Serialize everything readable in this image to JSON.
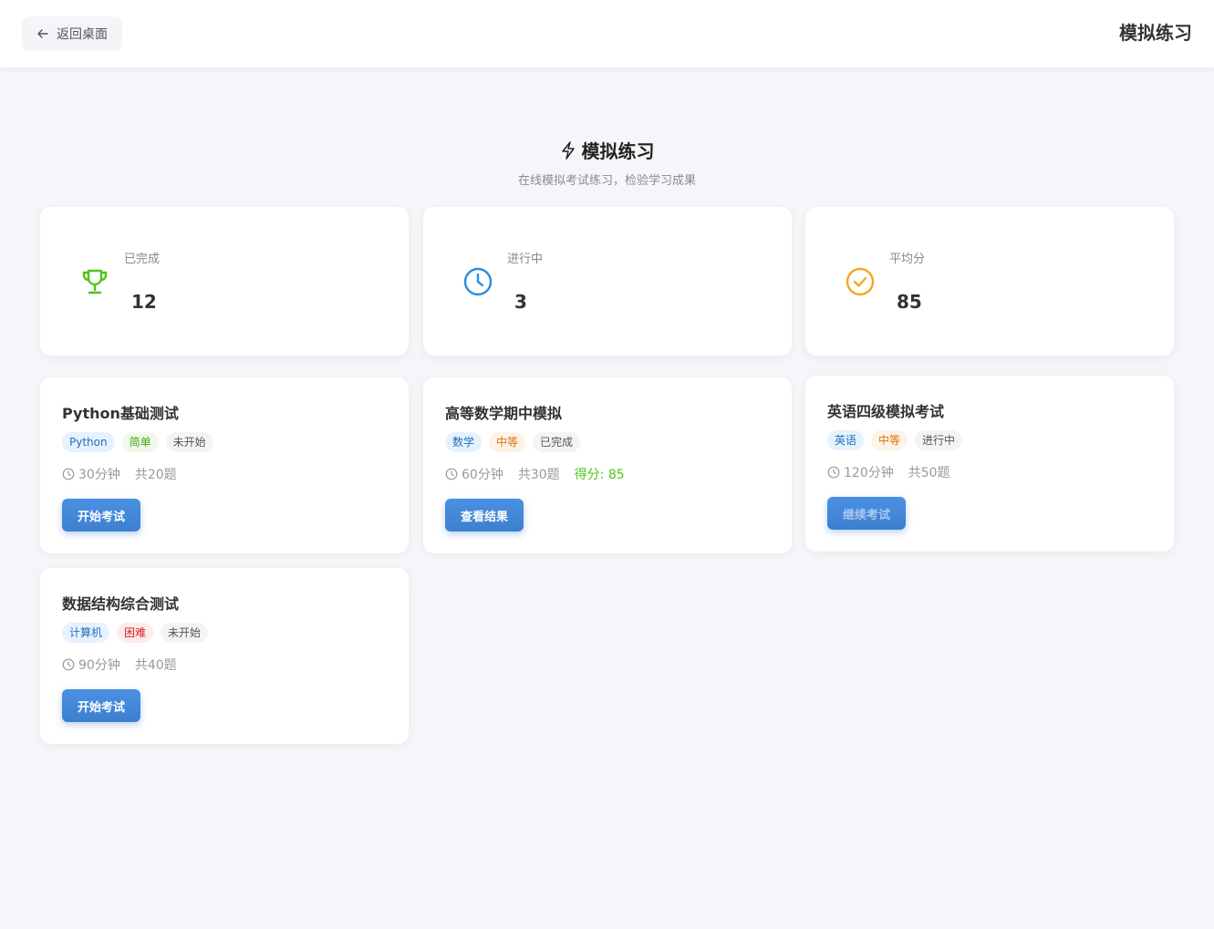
{
  "header": {
    "back_label": "返回桌面",
    "title": "模拟练习"
  },
  "page": {
    "title": "模拟练习",
    "subtitle": "在线模拟考试练习，检验学习成果"
  },
  "colors": {
    "primary": "#3d7fcf",
    "success": "#52c41a",
    "clock": "#2b8de0",
    "check": "#f5a623"
  },
  "stats": [
    {
      "label": "已完成",
      "value": "12",
      "icon": "trophy-icon"
    },
    {
      "label": "进行中",
      "value": "3",
      "icon": "clock-icon"
    },
    {
      "label": "平均分",
      "value": "85",
      "icon": "check-circle-icon"
    }
  ],
  "exams": [
    {
      "title": "Python基础测试",
      "tags": [
        "Python",
        "简单",
        "未开始"
      ],
      "duration": "30分钟",
      "count": "共20题",
      "score": "",
      "action": "开始考试"
    },
    {
      "title": "高等数学期中模拟",
      "tags": [
        "数学",
        "中等",
        "已完成"
      ],
      "duration": "60分钟",
      "count": "共30题",
      "score": "得分: 85",
      "action": "查看结果"
    },
    {
      "title": "英语四级模拟考试",
      "tags": [
        "英语",
        "中等",
        "进行中"
      ],
      "duration": "120分钟",
      "count": "共50题",
      "score": "",
      "action": "继续考试"
    },
    {
      "title": "数据结构综合测试",
      "tags": [
        "计算机",
        "困难",
        "未开始"
      ],
      "duration": "90分钟",
      "count": "共40题",
      "score": "",
      "action": "开始考试"
    }
  ]
}
